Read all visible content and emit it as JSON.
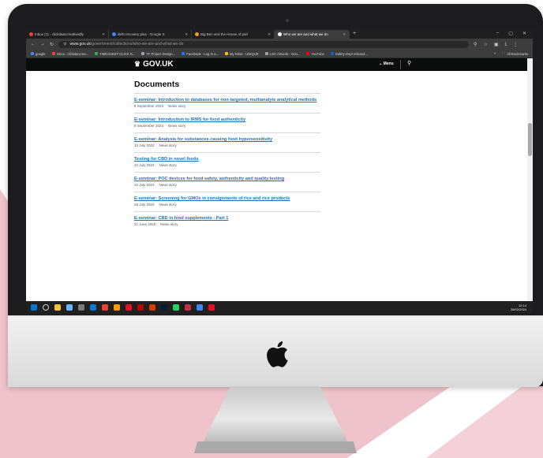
{
  "colors": {
    "pink": "#efc3cc",
    "gov_black": "#0b0c0c",
    "link_blue": "#1d70b8",
    "meta_grey": "#505a5f"
  },
  "browser": {
    "tabs": [
      {
        "label": "Inbox (1) - clickdaaccreativedfy",
        "fav_color": "#ea4335",
        "active": false
      },
      {
        "label": "debt recovery plus - Google S",
        "fav_color": "#4285f4",
        "active": false
      },
      {
        "label": "Big Ben and the House of parl",
        "fav_color": "#f59e0b",
        "active": false
      },
      {
        "label": "Who we are and what we do",
        "fav_color": "#ffffff",
        "active": true
      }
    ],
    "new_tab": "+",
    "window_controls": [
      "–",
      "▢",
      "✕"
    ],
    "url_host": "www.gov.uk",
    "url_path": "/government/collections/who-we-are-and-what-we-do",
    "bookmarks": [
      {
        "label": "google",
        "color": "#4285f4"
      },
      {
        "label": "Inbox - clickdaccrea...",
        "color": "#ea4335"
      },
      {
        "label": "TIMESHEET-CLICK D...",
        "color": "#34a853"
      },
      {
        "label": "TF Project Design...",
        "color": "#9aa0a6"
      },
      {
        "label": "Facebook - Log In o...",
        "color": "#1877f2"
      },
      {
        "label": "My Drive - UNIQUE",
        "color": "#fbbc04"
      },
      {
        "label": "LGC Artwork - Goo...",
        "color": "#9aa0a6"
      },
      {
        "label": "YouTube",
        "color": "#ff0000"
      },
      {
        "label": "Safety Dept rebrand...",
        "color": "#0a66c2"
      }
    ],
    "all_bookmarks": "All Bookmarks"
  },
  "gov": {
    "logo": "GOV.UK",
    "menu_label": "⌄ Menu",
    "section_heading": "Documents",
    "documents": [
      {
        "title": "E-seminar: Introduction to databases for non-targeted, multianalyte analytical methods",
        "date": "8 September 2023",
        "type": "News story"
      },
      {
        "title": "E-seminar: Introduction to IRMS for food authenticity",
        "date": "8 September 2023",
        "type": "News story"
      },
      {
        "title": "E-seminar: Analysis for substances causing food hypersensitivity",
        "date": "10 July 2023",
        "type": "News story"
      },
      {
        "title": "Testing for CBD in novel foods",
        "date": "10 July 2023",
        "type": "News story"
      },
      {
        "title": "E-seminar: POC devices for food safety, authenticity and quality testing",
        "date": "10 July 2023",
        "type": "News story"
      },
      {
        "title": "E-seminar: Screening for GMOs in consignments of rice and rice products",
        "date": "29 July 2022",
        "type": "News story"
      },
      {
        "title": "E-seminar: CBD in food supplements - Part 1",
        "date": "21 June 2022",
        "type": "News story"
      }
    ]
  },
  "taskbar": {
    "icons": [
      {
        "name": "windows-start-icon",
        "color": "#0078d4"
      },
      {
        "name": "search-icon",
        "color": "#cfcfcf"
      },
      {
        "name": "file-explorer-icon",
        "color": "#f5c33b"
      },
      {
        "name": "app-icon",
        "color": "#6cb6ff"
      },
      {
        "name": "app-icon",
        "color": "#7a7a7a"
      },
      {
        "name": "windows-icon",
        "color": "#0078d4"
      },
      {
        "name": "chrome-icon",
        "color": "#ea4335"
      },
      {
        "name": "app-icon",
        "color": "#f59e0b"
      },
      {
        "name": "app-icon",
        "color": "#e81123"
      },
      {
        "name": "acrobat-icon",
        "color": "#b30b00"
      },
      {
        "name": "app-icon",
        "color": "#d83b01"
      },
      {
        "name": "photoshop-icon",
        "color": "#001e36"
      },
      {
        "name": "whatsapp-icon",
        "color": "#25d366"
      },
      {
        "name": "app-icon",
        "color": "#c4314b"
      },
      {
        "name": "chrome-icon",
        "color": "#4285f4"
      },
      {
        "name": "app-icon",
        "color": "#e81123"
      }
    ],
    "time": "12:14",
    "date": "28/02/2024"
  }
}
